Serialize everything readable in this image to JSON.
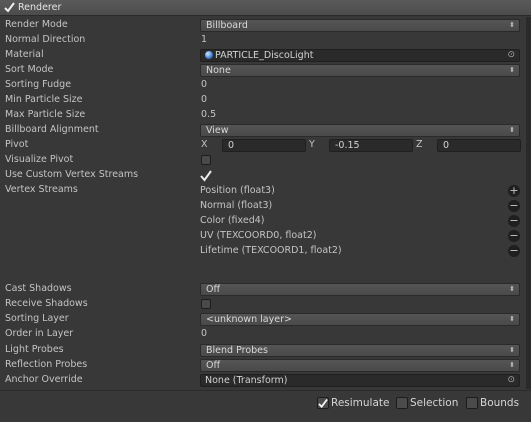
{
  "header": {
    "title": "Renderer",
    "enabled": true
  },
  "fields": {
    "render_mode": {
      "label": "Render Mode",
      "value": "Billboard"
    },
    "normal_direction": {
      "label": "Normal Direction",
      "value": "1"
    },
    "material": {
      "label": "Material",
      "value": "PARTICLE_DiscoLight"
    },
    "sort_mode": {
      "label": "Sort Mode",
      "value": "None"
    },
    "sorting_fudge": {
      "label": "Sorting Fudge",
      "value": "0"
    },
    "min_particle_size": {
      "label": "Min Particle Size",
      "value": "0"
    },
    "max_particle_size": {
      "label": "Max Particle Size",
      "value": "0.5"
    },
    "billboard_alignment": {
      "label": "Billboard Alignment",
      "value": "View"
    },
    "pivot": {
      "label": "Pivot",
      "x_label": "X",
      "x": "0",
      "y_label": "Y",
      "y": "-0.15",
      "z_label": "Z",
      "z": "0"
    },
    "visualize_pivot": {
      "label": "Visualize Pivot",
      "checked": false
    },
    "use_custom_vertex_streams": {
      "label": "Use Custom Vertex Streams",
      "checked": true
    },
    "vertex_streams": {
      "label": "Vertex Streams",
      "items": [
        "Position (float3)",
        "Normal (float3)",
        "Color (fixed4)",
        "UV (TEXCOORD0, float2)",
        "Lifetime (TEXCOORD1, float2)"
      ]
    },
    "cast_shadows": {
      "label": "Cast Shadows",
      "value": "Off"
    },
    "receive_shadows": {
      "label": "Receive Shadows",
      "checked": false
    },
    "sorting_layer": {
      "label": "Sorting Layer",
      "value": "<unknown layer>"
    },
    "order_in_layer": {
      "label": "Order in Layer",
      "value": "0"
    },
    "light_probes": {
      "label": "Light Probes",
      "value": "Blend Probes"
    },
    "reflection_probes": {
      "label": "Reflection Probes",
      "value": "Off"
    },
    "anchor_override": {
      "label": "Anchor Override",
      "value": "None (Transform)"
    }
  },
  "footer": {
    "resimulate": {
      "label": "Resimulate",
      "checked": true
    },
    "selection": {
      "label": "Selection",
      "checked": false
    },
    "bounds": {
      "label": "Bounds",
      "checked": false
    }
  },
  "colors": {
    "background": "#383838",
    "field": "#2a2a2a",
    "header": "#4c4c4c"
  }
}
